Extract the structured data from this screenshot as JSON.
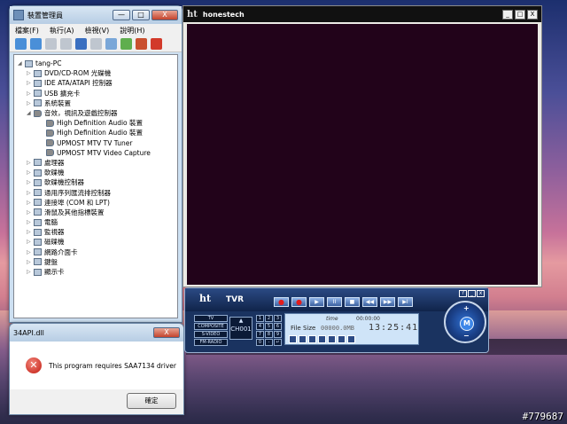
{
  "device_manager": {
    "title": "裝置管理員",
    "controls": {
      "minimize": "—",
      "maximize": "□",
      "close": "X"
    },
    "menu": [
      "檔案(F)",
      "執行(A)",
      "檢視(V)",
      "說明(H)"
    ],
    "toolbar_icons": [
      "back-icon",
      "forward-icon",
      "properties-icon",
      "list-icon",
      "help-icon",
      "device-view-icon",
      "scan-icon",
      "update-driver-icon",
      "disable-icon",
      "uninstall-icon"
    ],
    "tree": [
      {
        "label": "tang-PC",
        "level": 0,
        "expanded": true
      },
      {
        "label": "DVD/CD-ROM 光碟機",
        "level": 1
      },
      {
        "label": "IDE ATA/ATAPI 控制器",
        "level": 1
      },
      {
        "label": "USB 擴充卡",
        "level": 1
      },
      {
        "label": "系統裝置",
        "level": 1
      },
      {
        "label": "音效，視訊及遊戲控制器",
        "level": 1,
        "expanded": true
      },
      {
        "label": "High Definition Audio 裝置",
        "level": 2
      },
      {
        "label": "High Definition Audio 裝置",
        "level": 2
      },
      {
        "label": "UPMOST MTV TV Tuner",
        "level": 2
      },
      {
        "label": "UPMOST MTV Video Capture",
        "level": 2
      },
      {
        "label": "處理器",
        "level": 1
      },
      {
        "label": "軟碟機",
        "level": 1
      },
      {
        "label": "軟碟機控制器",
        "level": 1
      },
      {
        "label": "通用序列匯流排控制器",
        "level": 1
      },
      {
        "label": "連接埠 (COM 和 LPT)",
        "level": 1
      },
      {
        "label": "滑鼠及其他指標裝置",
        "level": 1
      },
      {
        "label": "電腦",
        "level": 1
      },
      {
        "label": "監視器",
        "level": 1
      },
      {
        "label": "磁碟機",
        "level": 1
      },
      {
        "label": "網路介面卡",
        "level": 1
      },
      {
        "label": "鍵盤",
        "level": 1
      },
      {
        "label": "顯示卡",
        "level": 1
      }
    ]
  },
  "error_dialog": {
    "title": "34API.dll",
    "close": "X",
    "message": "This program requires SAA7134 driver",
    "ok_label": "確定"
  },
  "video_window": {
    "logo": "ht",
    "title": "honestech",
    "controls": {
      "minimize": "_",
      "maximize": "□",
      "close": "X"
    }
  },
  "tvr_panel": {
    "logo": "ht",
    "name": "TVR",
    "transport": [
      "●",
      "●",
      "▶",
      "II",
      "■",
      "◀◀",
      "▶▶",
      "▶I"
    ],
    "sources": [
      "TV",
      "COMPOSITE",
      "S-VIDEO",
      "FM-RADIO"
    ],
    "channel": "CH001",
    "keypad": [
      "1",
      "2",
      "3",
      "4",
      "5",
      "6",
      "7",
      "8",
      "9",
      "0",
      "-",
      "↵"
    ],
    "time_label": "time",
    "time_value": "00:00:00",
    "file_size_label": "File Size",
    "file_size_value": "00000.0MB",
    "clock": "13:25:41",
    "jog": {
      "plus": "+",
      "center": "M",
      "minus": "−"
    }
  },
  "watermark": "#779687",
  "colors": {
    "accent": "#2f6fd0",
    "video_bg": "#22031a",
    "error_red": "#c21a10"
  }
}
